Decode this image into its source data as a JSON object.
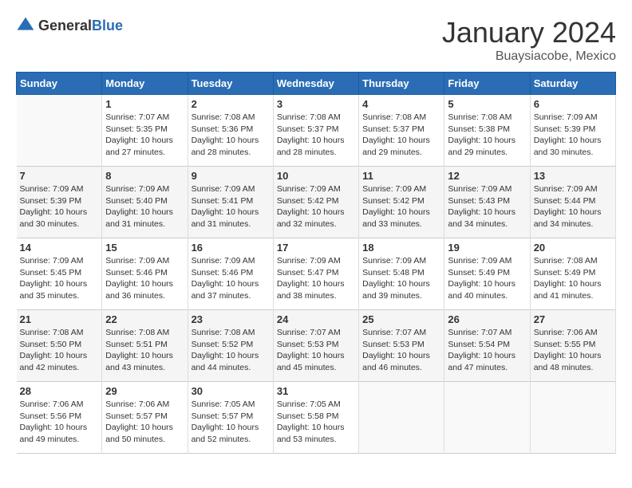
{
  "header": {
    "logo_general": "General",
    "logo_blue": "Blue",
    "month": "January 2024",
    "location": "Buaysiacobe, Mexico"
  },
  "weekdays": [
    "Sunday",
    "Monday",
    "Tuesday",
    "Wednesday",
    "Thursday",
    "Friday",
    "Saturday"
  ],
  "weeks": [
    [
      {
        "day": "",
        "info": ""
      },
      {
        "day": "1",
        "info": "Sunrise: 7:07 AM\nSunset: 5:35 PM\nDaylight: 10 hours\nand 27 minutes."
      },
      {
        "day": "2",
        "info": "Sunrise: 7:08 AM\nSunset: 5:36 PM\nDaylight: 10 hours\nand 28 minutes."
      },
      {
        "day": "3",
        "info": "Sunrise: 7:08 AM\nSunset: 5:37 PM\nDaylight: 10 hours\nand 28 minutes."
      },
      {
        "day": "4",
        "info": "Sunrise: 7:08 AM\nSunset: 5:37 PM\nDaylight: 10 hours\nand 29 minutes."
      },
      {
        "day": "5",
        "info": "Sunrise: 7:08 AM\nSunset: 5:38 PM\nDaylight: 10 hours\nand 29 minutes."
      },
      {
        "day": "6",
        "info": "Sunrise: 7:09 AM\nSunset: 5:39 PM\nDaylight: 10 hours\nand 30 minutes."
      }
    ],
    [
      {
        "day": "7",
        "info": "Sunrise: 7:09 AM\nSunset: 5:39 PM\nDaylight: 10 hours\nand 30 minutes."
      },
      {
        "day": "8",
        "info": "Sunrise: 7:09 AM\nSunset: 5:40 PM\nDaylight: 10 hours\nand 31 minutes."
      },
      {
        "day": "9",
        "info": "Sunrise: 7:09 AM\nSunset: 5:41 PM\nDaylight: 10 hours\nand 31 minutes."
      },
      {
        "day": "10",
        "info": "Sunrise: 7:09 AM\nSunset: 5:42 PM\nDaylight: 10 hours\nand 32 minutes."
      },
      {
        "day": "11",
        "info": "Sunrise: 7:09 AM\nSunset: 5:42 PM\nDaylight: 10 hours\nand 33 minutes."
      },
      {
        "day": "12",
        "info": "Sunrise: 7:09 AM\nSunset: 5:43 PM\nDaylight: 10 hours\nand 34 minutes."
      },
      {
        "day": "13",
        "info": "Sunrise: 7:09 AM\nSunset: 5:44 PM\nDaylight: 10 hours\nand 34 minutes."
      }
    ],
    [
      {
        "day": "14",
        "info": "Sunrise: 7:09 AM\nSunset: 5:45 PM\nDaylight: 10 hours\nand 35 minutes."
      },
      {
        "day": "15",
        "info": "Sunrise: 7:09 AM\nSunset: 5:46 PM\nDaylight: 10 hours\nand 36 minutes."
      },
      {
        "day": "16",
        "info": "Sunrise: 7:09 AM\nSunset: 5:46 PM\nDaylight: 10 hours\nand 37 minutes."
      },
      {
        "day": "17",
        "info": "Sunrise: 7:09 AM\nSunset: 5:47 PM\nDaylight: 10 hours\nand 38 minutes."
      },
      {
        "day": "18",
        "info": "Sunrise: 7:09 AM\nSunset: 5:48 PM\nDaylight: 10 hours\nand 39 minutes."
      },
      {
        "day": "19",
        "info": "Sunrise: 7:09 AM\nSunset: 5:49 PM\nDaylight: 10 hours\nand 40 minutes."
      },
      {
        "day": "20",
        "info": "Sunrise: 7:08 AM\nSunset: 5:49 PM\nDaylight: 10 hours\nand 41 minutes."
      }
    ],
    [
      {
        "day": "21",
        "info": "Sunrise: 7:08 AM\nSunset: 5:50 PM\nDaylight: 10 hours\nand 42 minutes."
      },
      {
        "day": "22",
        "info": "Sunrise: 7:08 AM\nSunset: 5:51 PM\nDaylight: 10 hours\nand 43 minutes."
      },
      {
        "day": "23",
        "info": "Sunrise: 7:08 AM\nSunset: 5:52 PM\nDaylight: 10 hours\nand 44 minutes."
      },
      {
        "day": "24",
        "info": "Sunrise: 7:07 AM\nSunset: 5:53 PM\nDaylight: 10 hours\nand 45 minutes."
      },
      {
        "day": "25",
        "info": "Sunrise: 7:07 AM\nSunset: 5:53 PM\nDaylight: 10 hours\nand 46 minutes."
      },
      {
        "day": "26",
        "info": "Sunrise: 7:07 AM\nSunset: 5:54 PM\nDaylight: 10 hours\nand 47 minutes."
      },
      {
        "day": "27",
        "info": "Sunrise: 7:06 AM\nSunset: 5:55 PM\nDaylight: 10 hours\nand 48 minutes."
      }
    ],
    [
      {
        "day": "28",
        "info": "Sunrise: 7:06 AM\nSunset: 5:56 PM\nDaylight: 10 hours\nand 49 minutes."
      },
      {
        "day": "29",
        "info": "Sunrise: 7:06 AM\nSunset: 5:57 PM\nDaylight: 10 hours\nand 50 minutes."
      },
      {
        "day": "30",
        "info": "Sunrise: 7:05 AM\nSunset: 5:57 PM\nDaylight: 10 hours\nand 52 minutes."
      },
      {
        "day": "31",
        "info": "Sunrise: 7:05 AM\nSunset: 5:58 PM\nDaylight: 10 hours\nand 53 minutes."
      },
      {
        "day": "",
        "info": ""
      },
      {
        "day": "",
        "info": ""
      },
      {
        "day": "",
        "info": ""
      }
    ]
  ]
}
